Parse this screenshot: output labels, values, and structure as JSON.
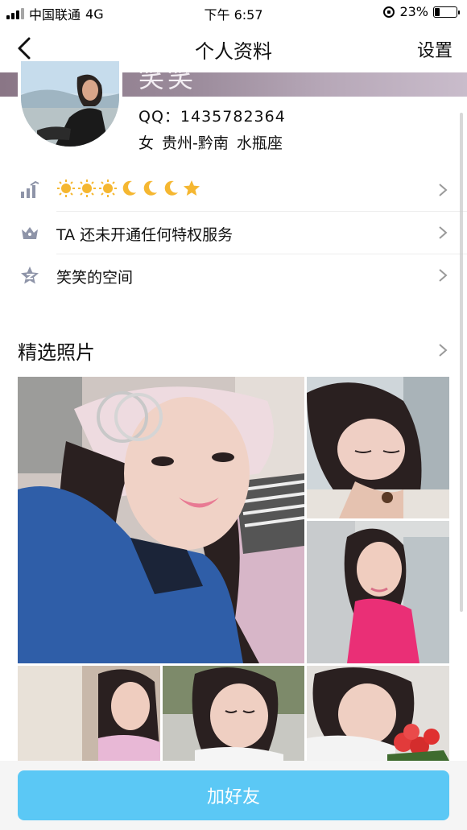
{
  "status_bar": {
    "carrier": "中国联通",
    "network": "4G",
    "time": "下午 6:57",
    "battery": "23%",
    "battery_level": 0.23
  },
  "nav": {
    "title": "个人资料",
    "settings_label": "设置"
  },
  "profile": {
    "name": "笑笑",
    "qq": "QQ：1435782364",
    "info": "女  贵州-黔南  水瓶座"
  },
  "rows": [
    {
      "id": "level",
      "label": "",
      "icons": [
        "sun-icon",
        "sun-icon",
        "sun-icon",
        "moon-icon",
        "moon-icon",
        "moon-icon",
        "star-icon"
      ]
    },
    {
      "id": "vip",
      "label": "TA 还未开通任何特权服务"
    },
    {
      "id": "space",
      "label": "笑笑的空间"
    }
  ],
  "photos_section": {
    "title": "精选照片"
  },
  "action": {
    "add_friend_label": "加好友"
  },
  "colors": {
    "accent": "#5bc8f5",
    "icon_gray": "#8e94a8",
    "sun": "#f5b731",
    "moon": "#f5b731"
  }
}
